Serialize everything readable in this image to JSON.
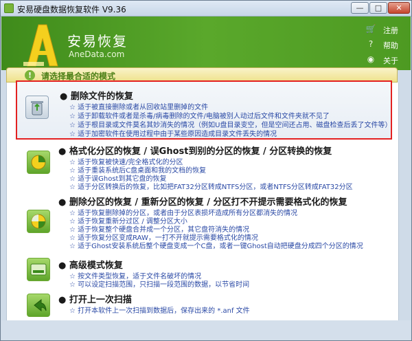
{
  "window": {
    "title": "安易硬盘数据恢复软件 V9.36",
    "min": "—",
    "max": "□",
    "close": "✕"
  },
  "header": {
    "brand": "安易恢复",
    "brand_sub": "AneData.com",
    "links": [
      {
        "label": "注册",
        "icon": "cart-icon"
      },
      {
        "label": "帮助",
        "icon": "help-icon"
      },
      {
        "label": "关于",
        "icon": "info-icon"
      }
    ]
  },
  "mode_bar": {
    "text": "请选择最合适的模式"
  },
  "options": [
    {
      "title": "删除文件的恢复",
      "icon": "recycle-bin-icon",
      "lines": [
        "☆ 适于被直接删除或者从回收站里删掉的文件",
        "☆ 适于卸载软件或者是杀毒/病毒删除的文件/电脑被别人动过后文件和文件夹就不见了",
        "☆ 适于根目录或文件莫名其妙消失的情况（例如U盘目录变空，但是空间还占用、磁盘检查后丢了文件等）",
        "☆ 适于加密软件在使用过程中由于某些原因造成目录文件丢失的情况"
      ]
    },
    {
      "title": "格式化分区的恢复 / 误Ghost到别的分区的恢复 / 分区转换的恢复",
      "icon": "format-disk-icon",
      "lines": [
        "☆ 适于恢复被快速/完全格式化的分区",
        "☆ 适于重装系统后C盘桌面和我的文档的恢复",
        "☆ 适于误Ghost到其它盘的恢复",
        "☆ 适于分区转换后的恢复，比如把FAT32分区转成NTFS分区，或者NTFS分区转成FAT32分区"
      ]
    },
    {
      "title": "删除分区的恢复 / 重新分区的恢复 / 分区打不开提示需要格式化的恢复",
      "icon": "partition-icon",
      "lines": [
        "☆ 适于恢复删除掉的分区，或者由于分区表损坏造成所有分区都消失的情况",
        "☆ 适于恢复重新分过区 / 调整分区大小",
        "☆ 适于恢复整个硬盘合并成一个分区，其它盘符消失的情况",
        "☆ 适于恢复分区变成RAW，一打不开就提示需要格式化的情况",
        "☆ 适于Ghost安装系统后整个硬盘变成一个C盘，或者一键Ghost自动把硬盘分成四个分区的情况"
      ]
    },
    {
      "title": "高级模式恢复",
      "icon": "hard-disk-icon",
      "lines": [
        "☆ 按文件类型恢复，适于文件名破坏的情况",
        "☆ 可以设定扫描范围，只扫描一段范围的数据，以节省时间"
      ]
    },
    {
      "title": "打开上一次扫描",
      "icon": "back-arrow-icon",
      "lines": [
        "☆ 打开本软件上一次扫描到数据后，保存出来的 *.anf 文件"
      ]
    }
  ],
  "colors": {
    "accent_green": "#5aa82b",
    "link_blue": "#2a49a5",
    "highlight_red": "#e32121"
  }
}
